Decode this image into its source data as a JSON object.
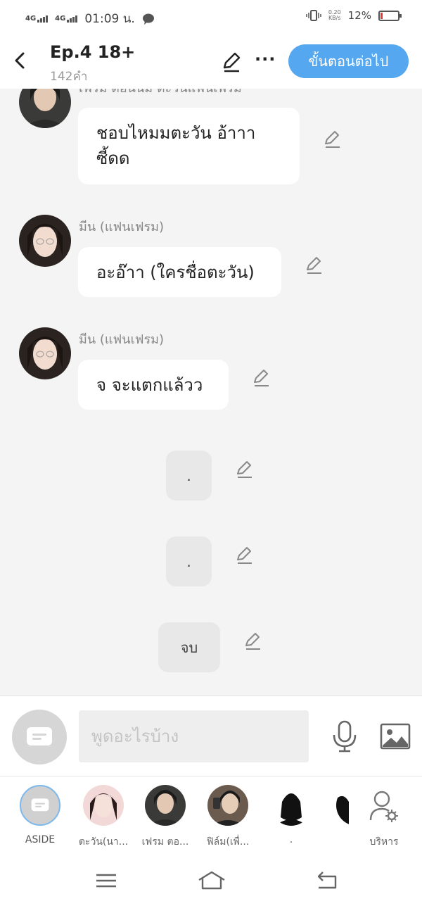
{
  "status": {
    "network1": "4G",
    "network2": "4G",
    "time": "01:09 น.",
    "speed": "0.20",
    "speed_unit": "KB/s",
    "battery": "12%"
  },
  "header": {
    "title": "Ep.4 18+",
    "subtitle": "142คำ",
    "next_label": "ขั้นตอนต่อไป",
    "more": "···"
  },
  "messages": [
    {
      "name": "เฟรม ตอนนี้มี ตะวันแฟนเฟรม",
      "line1": "ชอบไหมมตะวัน อ้าาา",
      "line2": "ซี้ดด"
    },
    {
      "name": "มีน (แฟนเฟรม)",
      "text": "อะอ๊าา (ใครชื่อตะวัน)"
    },
    {
      "name": "มีน (แฟนเฟรม)",
      "text": "จ จะแตกแล้วว"
    }
  ],
  "narration": [
    ".",
    ".",
    "จบ"
  ],
  "input": {
    "placeholder": "พูดอะไรบ้าง"
  },
  "characters": [
    {
      "label": "ASIDE"
    },
    {
      "label": "ตะวัน(นา..."
    },
    {
      "label": "เฟรม ตอ..."
    },
    {
      "label": "ฟิล์ม(เพื่..."
    },
    {
      "label": "."
    },
    {
      "label": ""
    },
    {
      "label": "บริหาร"
    }
  ],
  "colors": {
    "accent": "#55a8f0",
    "background": "#f4f4f4",
    "battery_low": "#e53935"
  }
}
